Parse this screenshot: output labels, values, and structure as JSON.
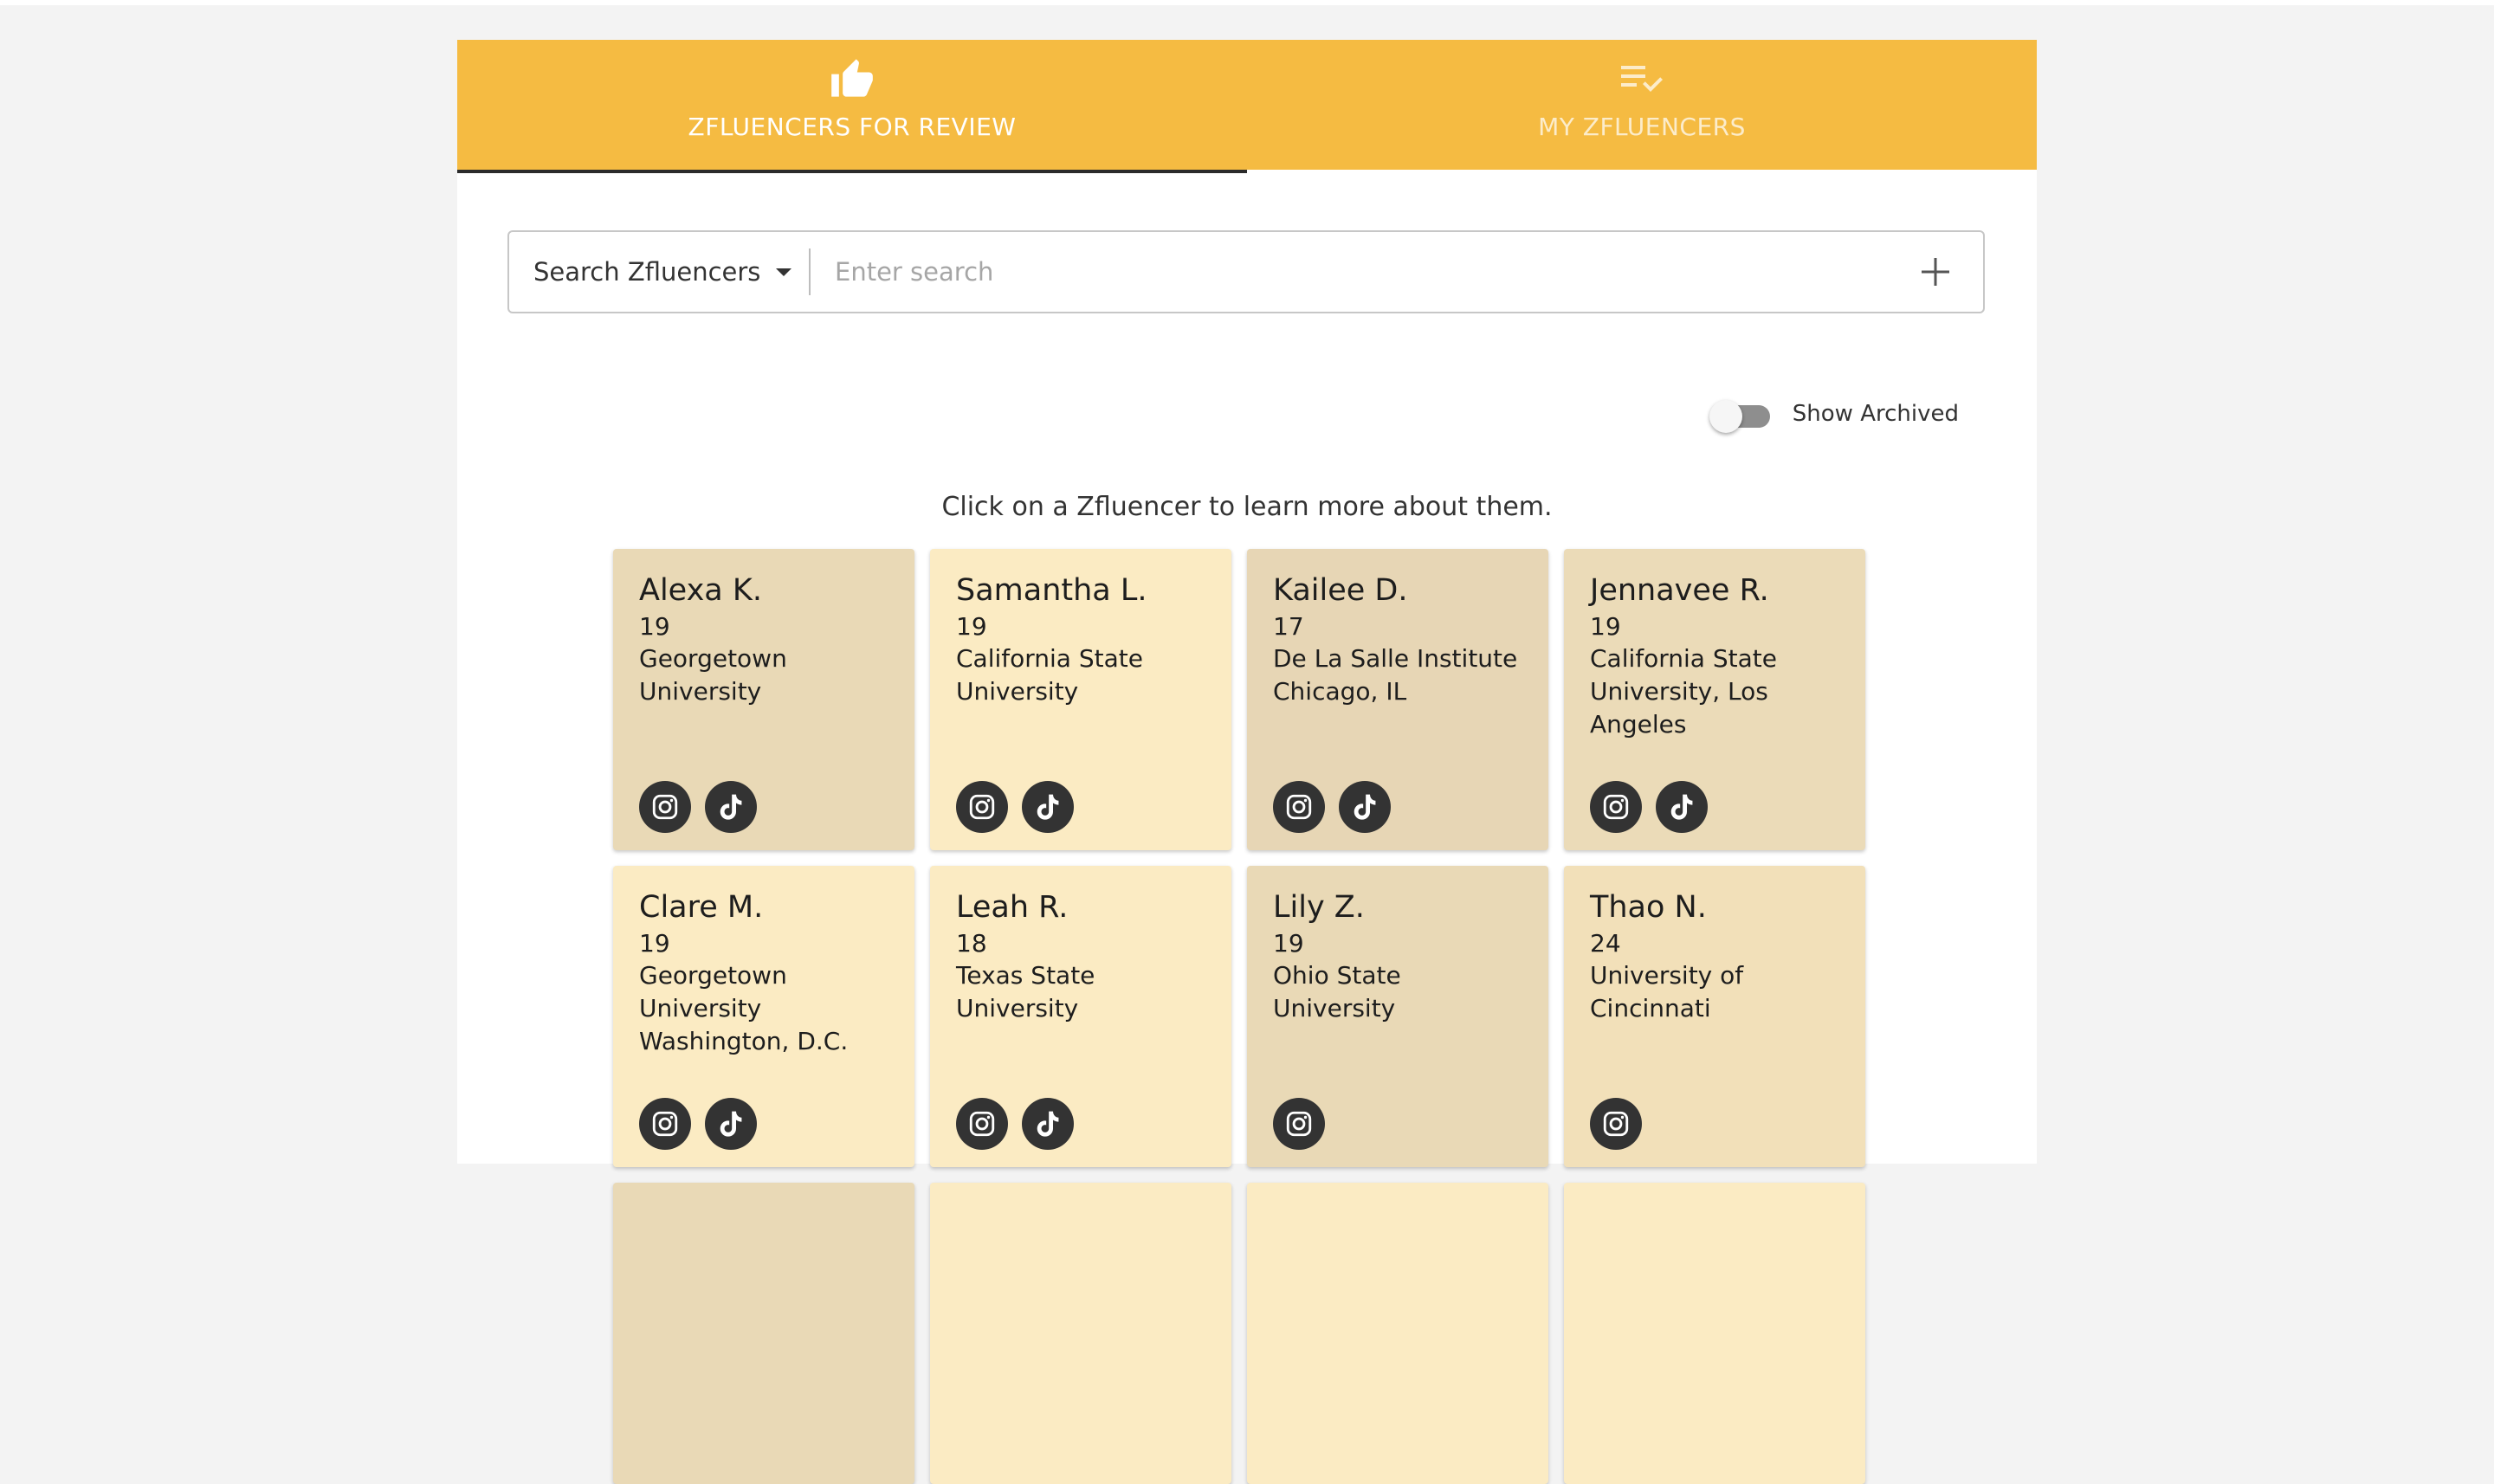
{
  "tabs": [
    {
      "label": "ZFLUENCERS FOR REVIEW",
      "icon": "thumbs-up-icon",
      "active": true
    },
    {
      "label": "MY ZFLUENCERS",
      "icon": "playlist-check-icon",
      "active": false
    }
  ],
  "search": {
    "select_label": "Search Zfluencers",
    "placeholder": "Enter search",
    "value": ""
  },
  "archived_toggle": {
    "label": "Show Archived",
    "on": false
  },
  "hint": "Click on a Zfluencer to learn more about them.",
  "cards": [
    {
      "name": "Alexa K.",
      "age": "19",
      "school": "Georgetown University",
      "socials": [
        "instagram",
        "tiktok"
      ],
      "bg": "#e9d9b6"
    },
    {
      "name": "Samantha L.",
      "age": "19",
      "school": "California State University",
      "socials": [
        "instagram",
        "tiktok"
      ],
      "bg": "#fbebc3"
    },
    {
      "name": "Kailee D.",
      "age": "17",
      "school": "De La Salle Institute Chicago, IL",
      "socials": [
        "instagram",
        "tiktok"
      ],
      "bg": "#e7d6b5"
    },
    {
      "name": "Jennavee R.",
      "age": "19",
      "school": "California State University, Los Angeles",
      "socials": [
        "instagram",
        "tiktok"
      ],
      "bg": "#ebdbb8"
    },
    {
      "name": "Clare M.",
      "age": "19",
      "school": "Georgetown University Washington, D.C.",
      "socials": [
        "instagram",
        "tiktok"
      ],
      "bg": "#fbebc3"
    },
    {
      "name": "Leah R.",
      "age": "18",
      "school": "Texas State University",
      "socials": [
        "instagram",
        "tiktok"
      ],
      "bg": "#fbebc3"
    },
    {
      "name": "Lily Z.",
      "age": "19",
      "school": "Ohio State University",
      "socials": [
        "instagram"
      ],
      "bg": "#e9d9b6"
    },
    {
      "name": "Thao N.",
      "age": "24",
      "school": "University of Cincinnati",
      "socials": [
        "instagram"
      ],
      "bg": "#f2e0b9"
    },
    {
      "name": "",
      "age": "",
      "school": "",
      "socials": [],
      "bg": "#e9d9b6"
    },
    {
      "name": "",
      "age": "",
      "school": "",
      "socials": [],
      "bg": "#fbebc3"
    },
    {
      "name": "",
      "age": "",
      "school": "",
      "socials": [],
      "bg": "#fbebc3"
    },
    {
      "name": "",
      "age": "",
      "school": "",
      "socials": [],
      "bg": "#fbebc3"
    }
  ],
  "colors": {
    "header": "#f5bb42",
    "social_bg": "#333333"
  }
}
